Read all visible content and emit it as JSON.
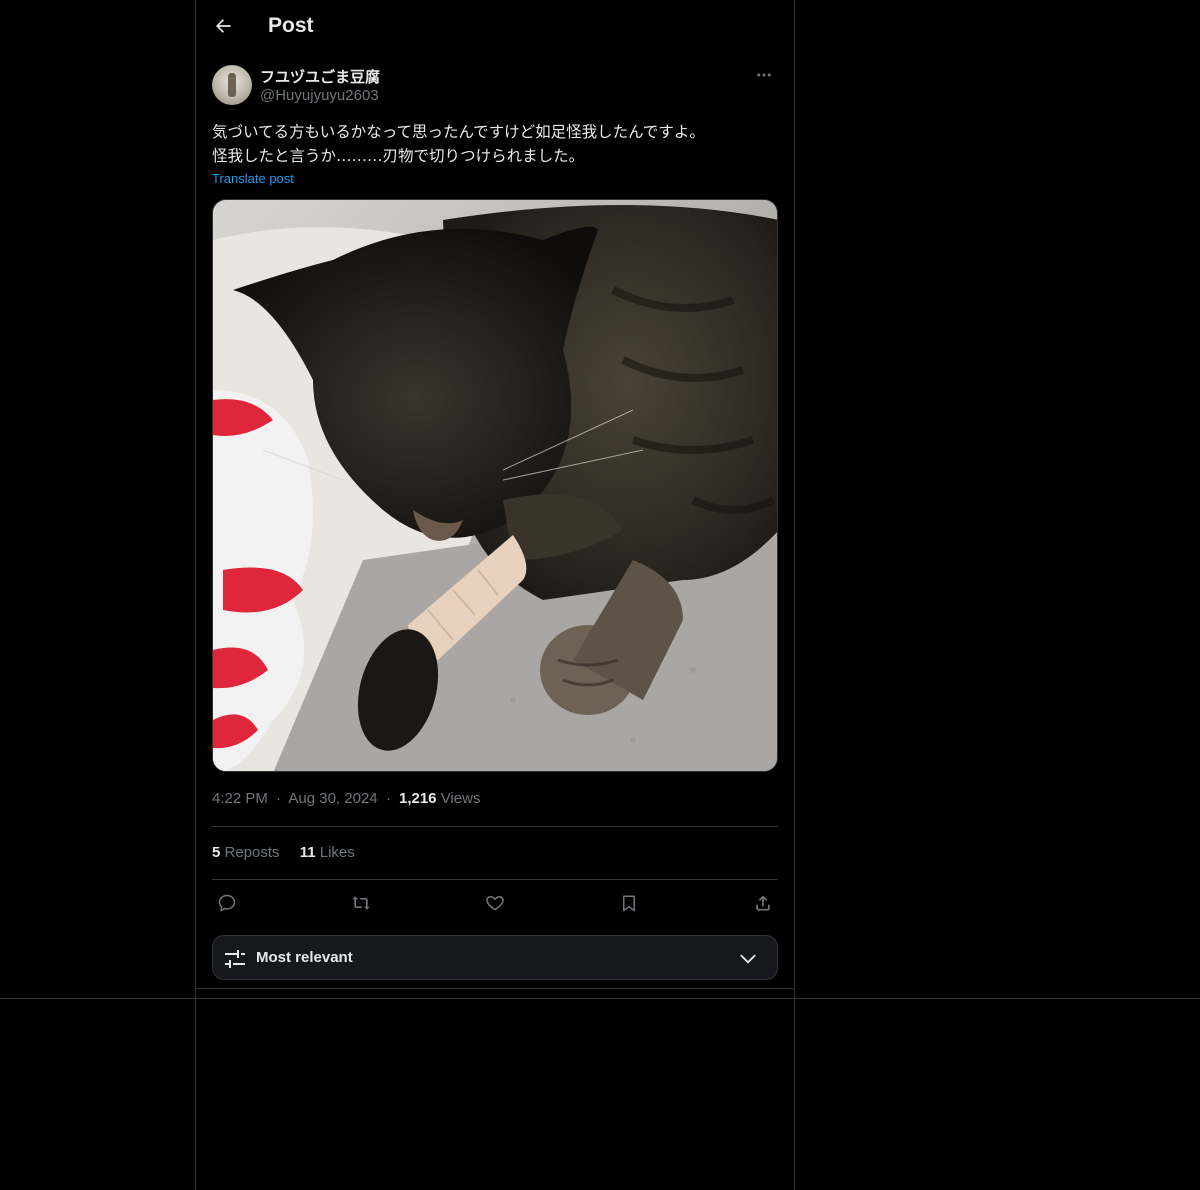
{
  "header": {
    "title": "Post"
  },
  "author": {
    "name": "フユヅユごま豆腐",
    "handle": "@Huyujyuyu2603"
  },
  "post": {
    "text_lines": [
      "気づいてる方もいるかなって思ったんですけど如足怪我したんですよ。",
      "怪我したと言うか………刃物で切りつけられました。"
    ],
    "translate_label": "Translate post",
    "time": "4:22 PM",
    "date": "Aug 30, 2024",
    "sep": "·",
    "views_count": "1,216",
    "views_label": "Views"
  },
  "stats": {
    "reposts_count": "5",
    "reposts_label": "Reposts",
    "likes_count": "11",
    "likes_label": "Likes"
  },
  "sort": {
    "label": "Most relevant"
  },
  "colors": {
    "accent": "#1d9bf0",
    "background": "#000000",
    "border": "#2f3336",
    "muted": "#71767b"
  },
  "icons": [
    "back-arrow-icon",
    "more-icon",
    "reply-icon",
    "repost-icon",
    "like-icon",
    "bookmark-icon",
    "share-icon",
    "sliders-icon",
    "chevron-down-icon"
  ]
}
